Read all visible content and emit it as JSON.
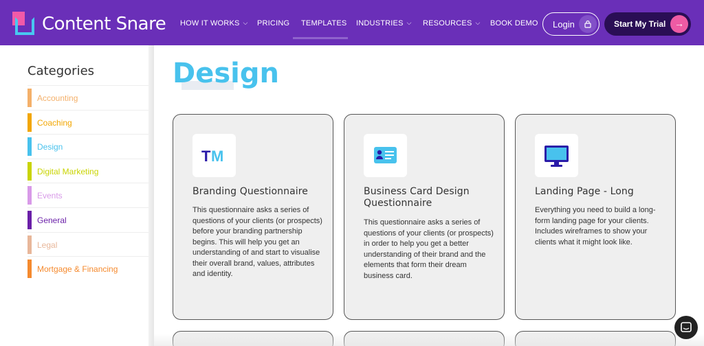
{
  "nav": {
    "brand": "Content Snare",
    "items": [
      {
        "label": "HOW IT WORKS",
        "dropdown": true
      },
      {
        "label": "PRICING",
        "dropdown": false
      },
      {
        "label": "TEMPLATES",
        "dropdown": false
      },
      {
        "label": "INDUSTRIES",
        "dropdown": true
      },
      {
        "label": "RESOURCES",
        "dropdown": true
      },
      {
        "label": "BOOK DEMO",
        "dropdown": false
      }
    ],
    "login_label": "Login",
    "trial_label": "Start My Trial",
    "colors": {
      "bg": "#6a2fb8",
      "trial_bg": "#2a0e55",
      "accent_pink": "#ee5ba4"
    }
  },
  "sidebar": {
    "title": "Categories",
    "items": [
      {
        "label": "Accounting",
        "color": "#f4b06a"
      },
      {
        "label": "Coaching",
        "color": "#f2a600"
      },
      {
        "label": "Design",
        "color": "#48c2ed"
      },
      {
        "label": "Digital Marketing",
        "color": "#c9d400"
      },
      {
        "label": "Events",
        "color": "#d89ae8"
      },
      {
        "label": "General",
        "color": "#6a1fa8"
      },
      {
        "label": "Legal",
        "color": "#e8b79a"
      },
      {
        "label": "Mortgage & Financing",
        "color": "#f58a2e"
      }
    ]
  },
  "main": {
    "title": "Design",
    "cards": [
      {
        "icon": "tm-logo-icon",
        "title": "Branding Questionnaire",
        "description": "This questionnaire asks a series of questions of your clients (or prospects) before your branding partnership begins. This will help you get an understanding of and start to visualise their overall brand, values, attributes and identity."
      },
      {
        "icon": "business-card-icon",
        "title": "Business Card Design Questionnaire",
        "description": "This questionnaire asks a series of questions of your clients (or prospects) in order to help you get a better understanding of their brand and the elements that form their dream business card."
      },
      {
        "icon": "monitor-icon",
        "title": "Landing Page - Long",
        "description": "Everything you need to build a long-form landing page for your clients. Includes wireframes to show your clients what it might look like."
      }
    ]
  }
}
